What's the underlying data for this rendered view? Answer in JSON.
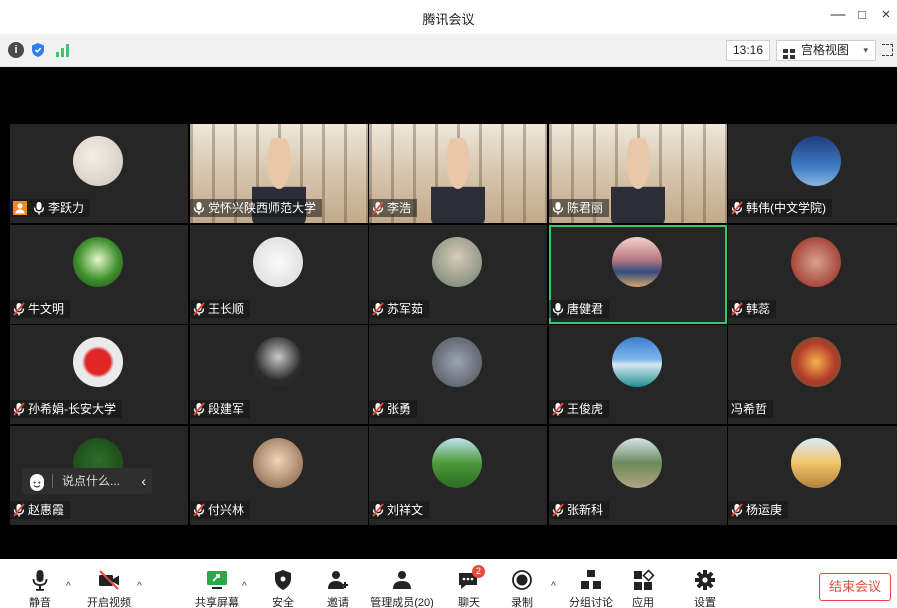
{
  "window": {
    "title": "腾讯会议",
    "minimize_glyph": "—",
    "maximize_glyph": "□",
    "close_glyph": "×"
  },
  "infobar": {
    "info_icon": "info-icon",
    "info_glyph": "i",
    "shield_icon": "shield-icon",
    "signal_icon": "signal-icon",
    "time": "13:16",
    "view_mode": "宫格视图",
    "view_caret": "▾"
  },
  "participants": [
    {
      "name": "李跃力",
      "host": true,
      "mic": "on",
      "avatar": "handwriting-avatar"
    },
    {
      "name": "党怀兴陕西师范大学",
      "mic": "on",
      "video": true
    },
    {
      "name": "李浩",
      "mic": "muted",
      "video": true
    },
    {
      "name": "陈君丽",
      "mic": "on",
      "video": true
    },
    {
      "name": "韩伟(中文学院)",
      "mic": "muted",
      "avatar": "sky-avatar"
    },
    {
      "name": "牛文明",
      "mic": "muted",
      "avatar": "forest-avatar"
    },
    {
      "name": "王长顺",
      "mic": "muted",
      "avatar": "calligraphy-avatar"
    },
    {
      "name": "苏军茹",
      "mic": "muted",
      "avatar": "woman-avatar"
    },
    {
      "name": "唐健君",
      "mic": "on",
      "avatar": "sunset-avatar",
      "active": true
    },
    {
      "name": "韩蕊",
      "mic": "muted",
      "avatar": "pattern-avatar"
    },
    {
      "name": "孙希娟-长安大学",
      "mic": "muted",
      "avatar": "rose-avatar"
    },
    {
      "name": "段建军",
      "mic": "muted",
      "avatar": "portrait-avatar"
    },
    {
      "name": "张勇",
      "mic": "muted",
      "avatar": "man-avatar"
    },
    {
      "name": "王俊虎",
      "mic": "muted",
      "avatar": "coast-avatar"
    },
    {
      "name": "冯希哲",
      "mic": "none",
      "avatar": "garden-avatar"
    },
    {
      "name": "赵惠霞",
      "mic": "muted",
      "avatar": "tree-avatar"
    },
    {
      "name": "付兴林",
      "mic": "muted",
      "avatar": "man2-avatar"
    },
    {
      "name": "刘祥文",
      "mic": "muted",
      "avatar": "park-avatar"
    },
    {
      "name": "张新科",
      "mic": "muted",
      "avatar": "lake-avatar"
    },
    {
      "name": "杨运庚",
      "mic": "muted",
      "avatar": "ship-avatar"
    }
  ],
  "chat": {
    "placeholder": "说点什么...",
    "collapse": "‹"
  },
  "toolbar": {
    "mute": "静音",
    "video": "开启视频",
    "share": "共享屏幕",
    "security": "安全",
    "invite": "邀请",
    "members": "管理成员(20)",
    "chat": "聊天",
    "chat_badge": "2",
    "record": "录制",
    "breakout": "分组讨论",
    "apps": "应用",
    "settings": "设置",
    "end": "结束会议",
    "chevron": "^"
  },
  "colors": {
    "accent_green": "#3ec46c",
    "end_red": "#e34c3c",
    "host_orange": "#f08a1e",
    "muted_red": "#e84a3b"
  }
}
